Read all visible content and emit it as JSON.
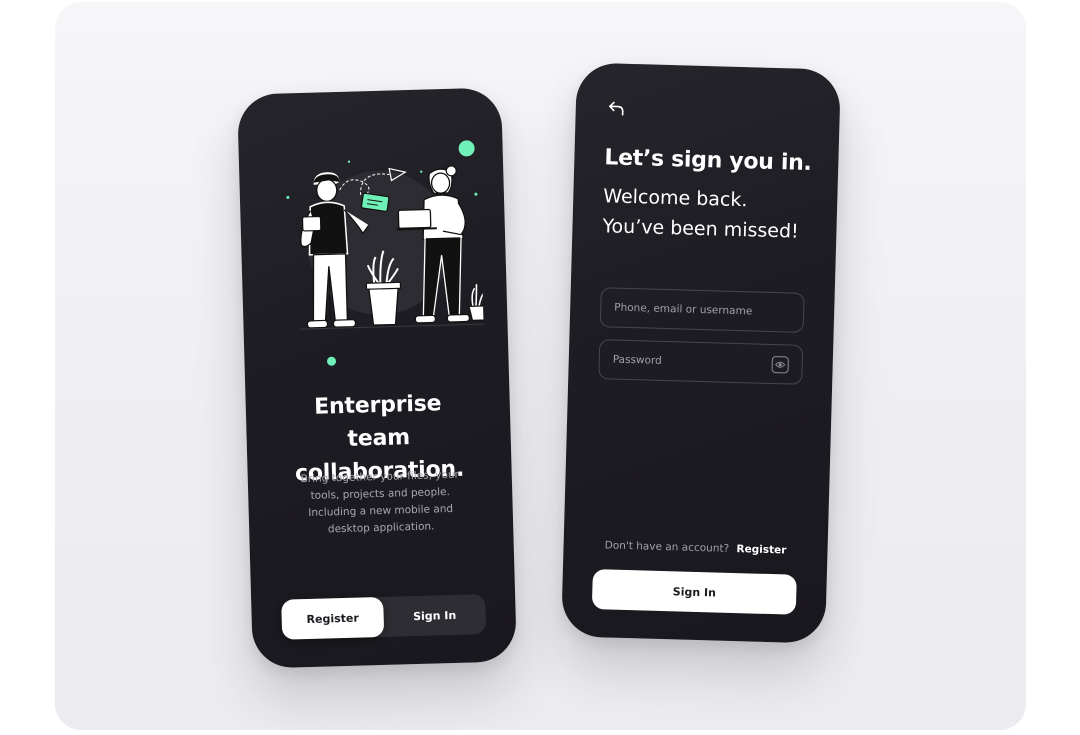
{
  "onboarding": {
    "title": "Enterprise team collaboration.",
    "description": "Bring together your files, your tools, projects and people. Including a new mobile and desktop application.",
    "register_label": "Register",
    "signin_label": "Sign In",
    "illustration": "two-people-collaborating-illustration"
  },
  "signin": {
    "back_icon": "back-arrow-icon",
    "title": "Let’s sign you in.",
    "welcome_line1": "Welcome back.",
    "welcome_line2": "You’ve been missed!",
    "username_placeholder": "Phone, email or username",
    "password_placeholder": "Password",
    "password_icon": "eye-icon",
    "no_account_text": "Don't have an account?",
    "register_link": "Register",
    "signin_button": "Sign In"
  },
  "colors": {
    "phone_bg": "#1d1c22",
    "accent_mint": "#6ff0b8",
    "primary_button": "#ffffff",
    "text_muted": "#a2a1a8"
  }
}
